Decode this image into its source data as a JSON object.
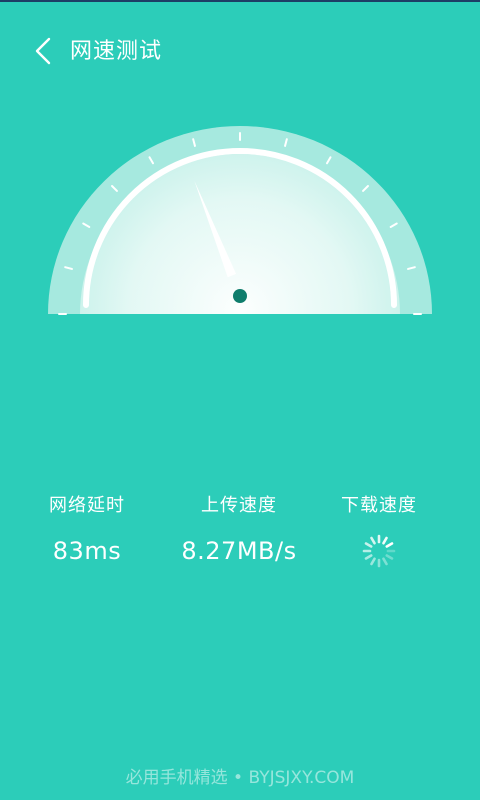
{
  "appbar": {
    "title": "网速测试",
    "back_icon": "chevron-left-icon"
  },
  "gauge": {
    "needle_fraction": 0.38
  },
  "stats": {
    "latency": {
      "label": "网络延时",
      "value": "83ms"
    },
    "upload": {
      "label": "上传速度",
      "value": "8.27MB/s"
    },
    "download": {
      "label": "下载速度",
      "state_icon": "loading-spinner-icon"
    }
  },
  "footer": {
    "watermark": "必用手机精选 • BYJSJXY.COM"
  },
  "colors": {
    "background": "#2ccdb9",
    "needle_pivot": "#0f7d6c"
  }
}
